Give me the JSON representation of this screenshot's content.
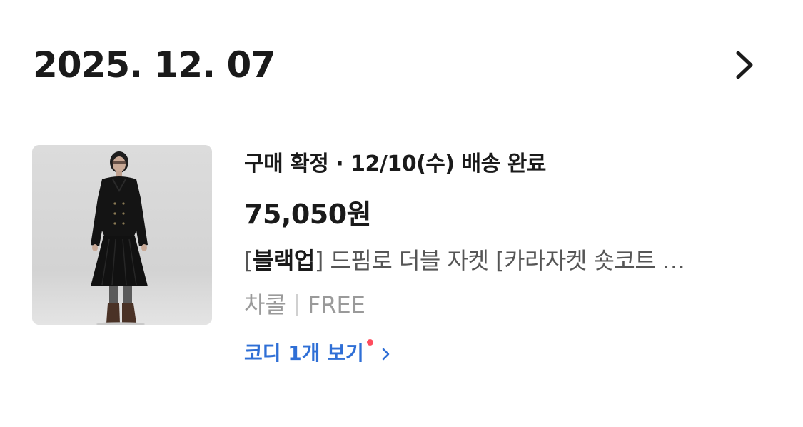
{
  "order": {
    "date": "2025. 12. 07",
    "status": "구매 확정 · 12/10(수) 배송 완료",
    "price": "75,050원",
    "product": {
      "brand": "블랙업",
      "name": "드핌로 더블 자켓 [카라자켓 숏코트 …",
      "color": "차콜",
      "size": "FREE"
    },
    "coordi_link": {
      "label": "코디 1개 보기",
      "has_new": true
    }
  },
  "icons": {
    "header_chevron": "chevron-right-icon",
    "link_chevron": "chevron-right-small-icon",
    "new_dot": "notification-dot-icon"
  },
  "colors": {
    "text_primary": "#1a1a1a",
    "text_secondary": "#555555",
    "text_muted": "#9a9a9a",
    "link": "#2f6fd6",
    "notification_dot": "#ff4d5e"
  }
}
